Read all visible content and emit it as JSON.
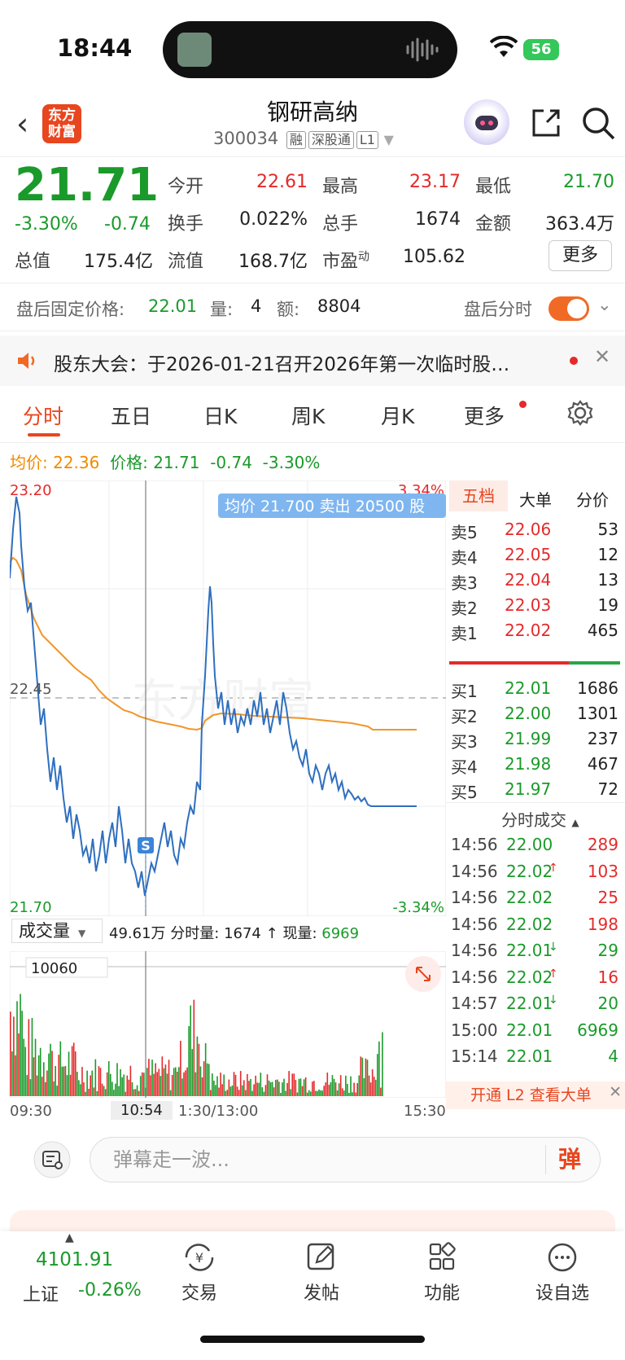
{
  "status": {
    "time": "18:44",
    "battery": "56"
  },
  "header": {
    "logo_line1": "东方",
    "logo_line2": "财富",
    "name": "钢研高纳",
    "code": "300034",
    "tags": [
      "融",
      "深股通",
      "L1"
    ]
  },
  "quote": {
    "price": "21.71",
    "change_pct": "-3.30%",
    "change": "-0.74",
    "open_label": "今开",
    "open": "22.61",
    "high_label": "最高",
    "high": "23.17",
    "low_label": "最低",
    "low": "21.70",
    "turnover_label": "换手",
    "turnover": "0.022%",
    "vol_label": "总手",
    "vol": "1674",
    "amount_label": "金额",
    "amount": "363.4万",
    "mcap_label": "总值",
    "mcap": "175.4亿",
    "float_label": "流值",
    "float": "168.7亿",
    "pe_label": "市盈",
    "pe_sup": "动",
    "pe": "105.62",
    "more": "更多"
  },
  "afterhours": {
    "label": "盘后固定价格:",
    "price": "22.01",
    "vol_label": "量:",
    "vol": "4",
    "amt_label": "额:",
    "amt": "8804",
    "switch_label": "盘后分时"
  },
  "notice": {
    "text": "股东大会：于2026-01-21召开2026年第一次临时股…"
  },
  "tabs": [
    "分时",
    "五日",
    "日K",
    "周K",
    "月K",
    "更多"
  ],
  "avg": {
    "avg_label": "均价:",
    "avg": "22.36",
    "price_label": "价格:",
    "price": "21.71",
    "chg": "-0.74",
    "pct": "-3.30%"
  },
  "chart": {
    "ymax": "23.20",
    "ymin": "21.70",
    "ymid": "22.45",
    "pct_top": "3.34%",
    "pct_bot": "-3.34%",
    "tooltip": "均价 21.700  卖出 20500 股",
    "s_marker": "S",
    "watermark": "东方财富"
  },
  "volume": {
    "dropdown": "成交量",
    "total": "49.61万",
    "fen_label": "分时量:",
    "fen": "1674",
    "arrow": "↑",
    "now_label": "现量:",
    "now": "6969",
    "axis_max": "10060",
    "t_start": "09:30",
    "t_cursor": "10:54",
    "t_mid": "1:30/13:00",
    "t_end": "15:30"
  },
  "book": {
    "tabs": [
      "五档",
      "大单",
      "分价"
    ],
    "asks": [
      {
        "l": "卖5",
        "p": "22.06",
        "v": "53"
      },
      {
        "l": "卖4",
        "p": "22.05",
        "v": "12"
      },
      {
        "l": "卖3",
        "p": "22.04",
        "v": "13"
      },
      {
        "l": "卖2",
        "p": "22.03",
        "v": "19"
      },
      {
        "l": "卖1",
        "p": "22.02",
        "v": "465"
      }
    ],
    "bids": [
      {
        "l": "买1",
        "p": "22.01",
        "v": "1686"
      },
      {
        "l": "买2",
        "p": "22.00",
        "v": "1301"
      },
      {
        "l": "买3",
        "p": "21.99",
        "v": "237"
      },
      {
        "l": "买4",
        "p": "21.98",
        "v": "467"
      },
      {
        "l": "买5",
        "p": "21.97",
        "v": "72"
      }
    ]
  },
  "ticks": {
    "title": "分时成交",
    "rows": [
      {
        "t": "14:56",
        "p": "22.00",
        "a": "",
        "v": "289"
      },
      {
        "t": "14:56",
        "p": "22.02",
        "a": "↑",
        "v": "103"
      },
      {
        "t": "14:56",
        "p": "22.02",
        "a": "",
        "v": "25"
      },
      {
        "t": "14:56",
        "p": "22.02",
        "a": "",
        "v": "198"
      },
      {
        "t": "14:56",
        "p": "22.01",
        "a": "↓",
        "v": "29"
      },
      {
        "t": "14:56",
        "p": "22.02",
        "a": "↑",
        "v": "16"
      },
      {
        "t": "14:57",
        "p": "22.01",
        "a": "↓",
        "v": "20"
      },
      {
        "t": "15:00",
        "p": "22.01",
        "a": "",
        "v": "6969"
      },
      {
        "t": "15:14",
        "p": "22.01",
        "a": "",
        "v": "4"
      }
    ],
    "l2": "开通 L2 查看大单"
  },
  "comment": {
    "placeholder": "弹幕走一波...",
    "send": "弹"
  },
  "bottom": {
    "index_value": "4101.91",
    "index_name": "上证",
    "index_pct": "-0.26%",
    "items": [
      "交易",
      "发帖",
      "功能",
      "设自选"
    ]
  },
  "colors": {
    "up": "#e42a2a",
    "down": "#1a9a2a",
    "avg": "#f0962a",
    "price": "#2f6fbf",
    "accent": "#e8461f"
  },
  "icons": [
    "back-icon",
    "share-icon",
    "search-icon",
    "speaker-icon",
    "close-icon",
    "settings-icon",
    "expand-icon",
    "trade-icon",
    "post-icon",
    "function-icon",
    "watchlist-icon"
  ]
}
